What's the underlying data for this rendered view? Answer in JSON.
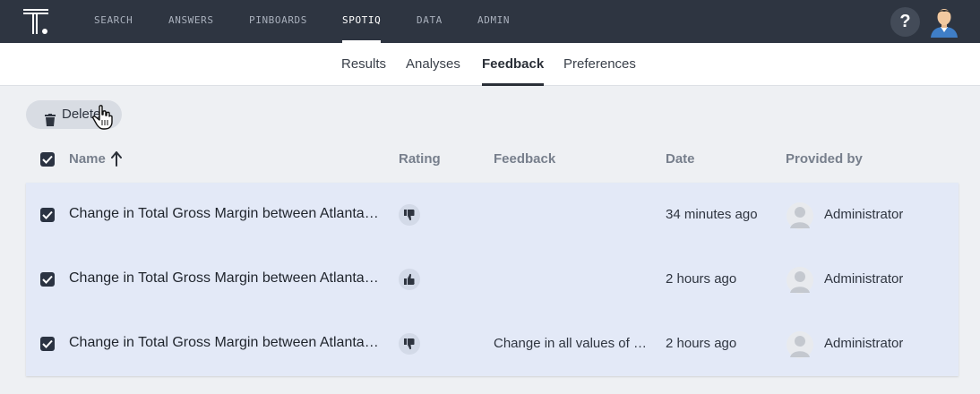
{
  "app": {
    "logo_icon": "thoughtspot-logo-icon",
    "nav": [
      {
        "label": "SEARCH",
        "active": false
      },
      {
        "label": "ANSWERS",
        "active": false
      },
      {
        "label": "PINBOARDS",
        "active": false
      },
      {
        "label": "SPOTIQ",
        "active": true
      },
      {
        "label": "DATA",
        "active": false
      },
      {
        "label": "ADMIN",
        "active": false
      }
    ],
    "help_label": "?",
    "help_icon": "help-icon",
    "user_avatar_icon": "user-avatar-icon"
  },
  "subnav": {
    "tabs": [
      {
        "label": "Results",
        "active": false
      },
      {
        "label": "Analyses",
        "active": false
      },
      {
        "label": "Feedback",
        "active": true
      },
      {
        "label": "Preferences",
        "active": false
      }
    ]
  },
  "toolbar": {
    "delete_label": "Delete",
    "delete_icon": "trash-icon"
  },
  "table": {
    "columns": {
      "name": "Name",
      "rating": "Rating",
      "feedback": "Feedback",
      "date": "Date",
      "provided_by": "Provided by"
    },
    "sort": {
      "column": "Name",
      "direction": "ascending",
      "icon": "arrow-up-icon"
    },
    "select_all_checked": true,
    "rows": [
      {
        "checked": true,
        "name": "Change in Total Gross Margin between Atlanta …",
        "rating": "thumbs-down",
        "feedback": "",
        "date": "34 minutes ago",
        "provided_by": "Administrator"
      },
      {
        "checked": true,
        "name": "Change in Total Gross Margin between Atlanta …",
        "rating": "thumbs-up",
        "feedback": "",
        "date": "2 hours ago",
        "provided_by": "Administrator"
      },
      {
        "checked": true,
        "name": "Change in Total Gross Margin between Atlanta …",
        "rating": "thumbs-down",
        "feedback": "Change in all values of St…",
        "date": "2 hours ago",
        "provided_by": "Administrator"
      }
    ]
  },
  "colors": {
    "topbar": "#2e3541",
    "row_selected": "#e3e9f7",
    "page_bg": "#eef0f3"
  }
}
